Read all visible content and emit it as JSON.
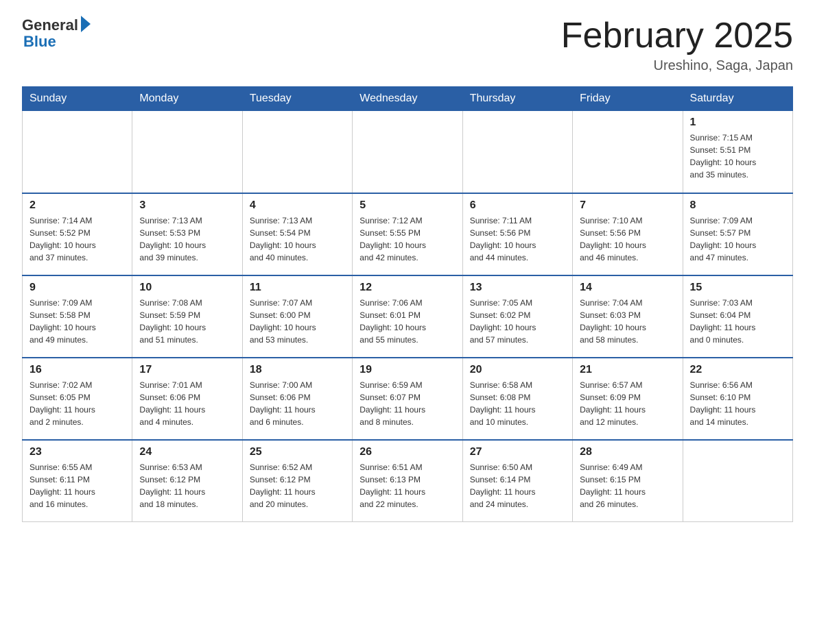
{
  "header": {
    "logo_general": "General",
    "logo_blue": "Blue",
    "month_title": "February 2025",
    "location": "Ureshino, Saga, Japan"
  },
  "days_of_week": [
    "Sunday",
    "Monday",
    "Tuesday",
    "Wednesday",
    "Thursday",
    "Friday",
    "Saturday"
  ],
  "weeks": [
    [
      {
        "day": "",
        "info": ""
      },
      {
        "day": "",
        "info": ""
      },
      {
        "day": "",
        "info": ""
      },
      {
        "day": "",
        "info": ""
      },
      {
        "day": "",
        "info": ""
      },
      {
        "day": "",
        "info": ""
      },
      {
        "day": "1",
        "info": "Sunrise: 7:15 AM\nSunset: 5:51 PM\nDaylight: 10 hours\nand 35 minutes."
      }
    ],
    [
      {
        "day": "2",
        "info": "Sunrise: 7:14 AM\nSunset: 5:52 PM\nDaylight: 10 hours\nand 37 minutes."
      },
      {
        "day": "3",
        "info": "Sunrise: 7:13 AM\nSunset: 5:53 PM\nDaylight: 10 hours\nand 39 minutes."
      },
      {
        "day": "4",
        "info": "Sunrise: 7:13 AM\nSunset: 5:54 PM\nDaylight: 10 hours\nand 40 minutes."
      },
      {
        "day": "5",
        "info": "Sunrise: 7:12 AM\nSunset: 5:55 PM\nDaylight: 10 hours\nand 42 minutes."
      },
      {
        "day": "6",
        "info": "Sunrise: 7:11 AM\nSunset: 5:56 PM\nDaylight: 10 hours\nand 44 minutes."
      },
      {
        "day": "7",
        "info": "Sunrise: 7:10 AM\nSunset: 5:56 PM\nDaylight: 10 hours\nand 46 minutes."
      },
      {
        "day": "8",
        "info": "Sunrise: 7:09 AM\nSunset: 5:57 PM\nDaylight: 10 hours\nand 47 minutes."
      }
    ],
    [
      {
        "day": "9",
        "info": "Sunrise: 7:09 AM\nSunset: 5:58 PM\nDaylight: 10 hours\nand 49 minutes."
      },
      {
        "day": "10",
        "info": "Sunrise: 7:08 AM\nSunset: 5:59 PM\nDaylight: 10 hours\nand 51 minutes."
      },
      {
        "day": "11",
        "info": "Sunrise: 7:07 AM\nSunset: 6:00 PM\nDaylight: 10 hours\nand 53 minutes."
      },
      {
        "day": "12",
        "info": "Sunrise: 7:06 AM\nSunset: 6:01 PM\nDaylight: 10 hours\nand 55 minutes."
      },
      {
        "day": "13",
        "info": "Sunrise: 7:05 AM\nSunset: 6:02 PM\nDaylight: 10 hours\nand 57 minutes."
      },
      {
        "day": "14",
        "info": "Sunrise: 7:04 AM\nSunset: 6:03 PM\nDaylight: 10 hours\nand 58 minutes."
      },
      {
        "day": "15",
        "info": "Sunrise: 7:03 AM\nSunset: 6:04 PM\nDaylight: 11 hours\nand 0 minutes."
      }
    ],
    [
      {
        "day": "16",
        "info": "Sunrise: 7:02 AM\nSunset: 6:05 PM\nDaylight: 11 hours\nand 2 minutes."
      },
      {
        "day": "17",
        "info": "Sunrise: 7:01 AM\nSunset: 6:06 PM\nDaylight: 11 hours\nand 4 minutes."
      },
      {
        "day": "18",
        "info": "Sunrise: 7:00 AM\nSunset: 6:06 PM\nDaylight: 11 hours\nand 6 minutes."
      },
      {
        "day": "19",
        "info": "Sunrise: 6:59 AM\nSunset: 6:07 PM\nDaylight: 11 hours\nand 8 minutes."
      },
      {
        "day": "20",
        "info": "Sunrise: 6:58 AM\nSunset: 6:08 PM\nDaylight: 11 hours\nand 10 minutes."
      },
      {
        "day": "21",
        "info": "Sunrise: 6:57 AM\nSunset: 6:09 PM\nDaylight: 11 hours\nand 12 minutes."
      },
      {
        "day": "22",
        "info": "Sunrise: 6:56 AM\nSunset: 6:10 PM\nDaylight: 11 hours\nand 14 minutes."
      }
    ],
    [
      {
        "day": "23",
        "info": "Sunrise: 6:55 AM\nSunset: 6:11 PM\nDaylight: 11 hours\nand 16 minutes."
      },
      {
        "day": "24",
        "info": "Sunrise: 6:53 AM\nSunset: 6:12 PM\nDaylight: 11 hours\nand 18 minutes."
      },
      {
        "day": "25",
        "info": "Sunrise: 6:52 AM\nSunset: 6:12 PM\nDaylight: 11 hours\nand 20 minutes."
      },
      {
        "day": "26",
        "info": "Sunrise: 6:51 AM\nSunset: 6:13 PM\nDaylight: 11 hours\nand 22 minutes."
      },
      {
        "day": "27",
        "info": "Sunrise: 6:50 AM\nSunset: 6:14 PM\nDaylight: 11 hours\nand 24 minutes."
      },
      {
        "day": "28",
        "info": "Sunrise: 6:49 AM\nSunset: 6:15 PM\nDaylight: 11 hours\nand 26 minutes."
      },
      {
        "day": "",
        "info": ""
      }
    ]
  ]
}
